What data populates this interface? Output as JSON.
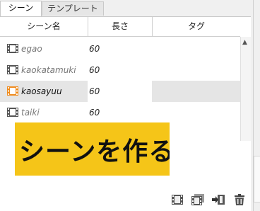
{
  "tabs": [
    {
      "label": "シーン",
      "active": true
    },
    {
      "label": "テンプレート",
      "active": false
    }
  ],
  "table": {
    "columns": [
      "シーン名",
      "長さ",
      "タグ"
    ],
    "rows": [
      {
        "name": "egao",
        "length": "60",
        "selected": false
      },
      {
        "name": "kaokatamuki",
        "length": "60",
        "selected": false
      },
      {
        "name": "kaosayuu",
        "length": "60",
        "selected": true
      },
      {
        "name": "taiki",
        "length": "60",
        "selected": false
      }
    ]
  },
  "overlay": {
    "create_scene_label": "シーンを作る",
    "bg_color": "#f5c518"
  },
  "toolbar": {
    "icons": [
      "scene-film-icon",
      "scene-film-stack-icon",
      "import-scene-icon",
      "trash-icon"
    ]
  },
  "colors": {
    "selected_icon": "#f08c1e",
    "icon": "#555555",
    "selected_row": "#e5e5e5"
  }
}
